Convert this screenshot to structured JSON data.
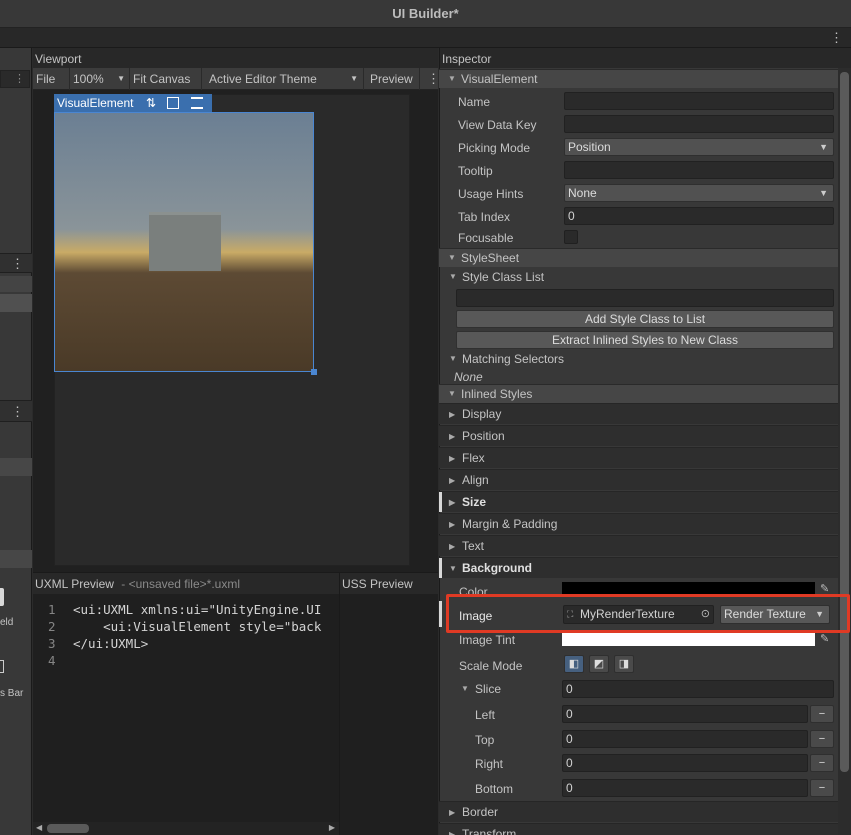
{
  "window": {
    "title": "UI Builder*"
  },
  "viewport": {
    "title": "Viewport",
    "toolbar": {
      "file_label": "File",
      "zoom_value": "100%",
      "fit_canvas_label": "Fit Canvas",
      "theme_value": "Active Editor Theme",
      "preview_label": "Preview"
    },
    "element_tab_label": "VisualElement"
  },
  "uxml_preview": {
    "title": "UXML Preview",
    "filename": "- <unsaved file>*.uxml",
    "lines": [
      {
        "num": "1",
        "code": "<ui:UXML xmlns:ui=\"UnityEngine.UI"
      },
      {
        "num": "2",
        "code": "    <ui:VisualElement style=\"back"
      },
      {
        "num": "3",
        "code": "</ui:UXML>"
      },
      {
        "num": "4",
        "code": ""
      }
    ]
  },
  "uss_preview": {
    "title": "USS Preview"
  },
  "left_panel": {
    "partial_text_1": "eld",
    "partial_text_2": "s Bar"
  },
  "inspector": {
    "title": "Inspector",
    "visual_element": {
      "header": "VisualElement",
      "name_label": "Name",
      "name_value": "",
      "view_data_key_label": "View Data Key",
      "view_data_key_value": "",
      "picking_mode_label": "Picking Mode",
      "picking_mode_value": "Position",
      "tooltip_label": "Tooltip",
      "tooltip_value": "",
      "usage_hints_label": "Usage Hints",
      "usage_hints_value": "None",
      "tab_index_label": "Tab Index",
      "tab_index_value": "0",
      "focusable_label": "Focusable",
      "focusable_checked": false
    },
    "stylesheet": {
      "header": "StyleSheet",
      "style_class_list_label": "Style Class List",
      "class_input_value": "",
      "add_button": "Add Style Class to List",
      "extract_button": "Extract Inlined Styles to New Class",
      "matching_selectors_label": "Matching Selectors",
      "matching_value": "None"
    },
    "inlined_styles": {
      "header": "Inlined Styles",
      "groups": {
        "display": "Display",
        "position": "Position",
        "flex": "Flex",
        "align": "Align",
        "size": "Size",
        "margin": "Margin & Padding",
        "text": "Text",
        "background": "Background",
        "border": "Border",
        "transform": "Transform"
      },
      "background": {
        "color_label": "Color",
        "color_value": "#000000",
        "image_label": "Image",
        "image_value": "MyRenderTexture",
        "image_type": "Render Texture",
        "image_tint_label": "Image Tint",
        "image_tint_value": "#ffffff",
        "scale_mode_label": "Scale Mode",
        "slice_label": "Slice",
        "slice_value": "0",
        "left_label": "Left",
        "left_value": "0",
        "top_label": "Top",
        "top_value": "0",
        "right_label": "Right",
        "right_value": "0",
        "bottom_label": "Bottom",
        "bottom_value": "0"
      }
    }
  }
}
